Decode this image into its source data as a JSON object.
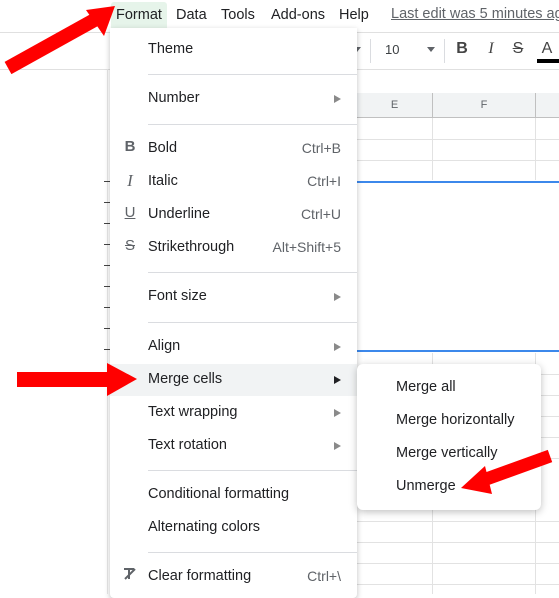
{
  "menubar": {
    "items": [
      {
        "label": "Format",
        "active": true
      },
      {
        "label": "Data"
      },
      {
        "label": "Tools"
      },
      {
        "label": "Add-ons"
      },
      {
        "label": "Help"
      }
    ],
    "last_edit": "Last edit was 5 minutes ago"
  },
  "toolbar": {
    "font_size": "10",
    "bold_icon": "B",
    "italic_icon": "I",
    "strikethrough_icon": "S",
    "text_color_icon": "A"
  },
  "grid": {
    "column_headers": [
      "E",
      "F",
      ""
    ]
  },
  "format_menu": {
    "items": [
      {
        "label": "Theme"
      },
      {
        "label": "Number",
        "submenu": true
      },
      {
        "label": "Bold",
        "icon": "bold-icon",
        "shortcut": "Ctrl+B"
      },
      {
        "label": "Italic",
        "icon": "italic-icon",
        "shortcut": "Ctrl+I"
      },
      {
        "label": "Underline",
        "icon": "underline-icon",
        "shortcut": "Ctrl+U"
      },
      {
        "label": "Strikethrough",
        "icon": "strikethrough-icon",
        "shortcut": "Alt+Shift+5"
      },
      {
        "label": "Font size",
        "submenu": true
      },
      {
        "label": "Align",
        "submenu": true
      },
      {
        "label": "Merge cells",
        "submenu": true,
        "highlighted": true
      },
      {
        "label": "Text wrapping",
        "submenu": true
      },
      {
        "label": "Text rotation",
        "submenu": true
      },
      {
        "label": "Conditional formatting"
      },
      {
        "label": "Alternating colors"
      },
      {
        "label": "Clear formatting",
        "icon": "clear-formatting-icon",
        "shortcut": "Ctrl+\\"
      }
    ],
    "icon_glyphs": {
      "bold": "B",
      "italic": "I",
      "underline": "U",
      "strikethrough": "S",
      "clear": "T"
    }
  },
  "merge_submenu": {
    "items": [
      {
        "label": "Merge all"
      },
      {
        "label": "Merge horizontally"
      },
      {
        "label": "Merge vertically"
      },
      {
        "label": "Unmerge"
      }
    ]
  },
  "annotations": {
    "arrow_color": "#ff0000",
    "arrows": [
      "points-to-format-menu",
      "points-to-merge-cells",
      "points-to-unmerge"
    ]
  },
  "colors": {
    "active_menu_bg": "#e6f4ea",
    "selection_border": "#1a73e8",
    "hover_bg": "#f1f3f4"
  }
}
